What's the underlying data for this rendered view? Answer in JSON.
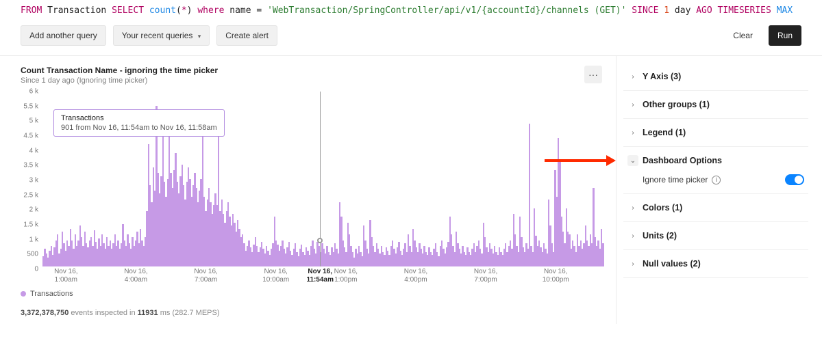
{
  "query": {
    "tokens": [
      {
        "t": "FROM",
        "c": "kw"
      },
      {
        "t": " "
      },
      {
        "t": "Transaction",
        "c": "ent"
      },
      {
        "t": " "
      },
      {
        "t": "SELECT",
        "c": "kw"
      },
      {
        "t": " "
      },
      {
        "t": "count",
        "c": "fn"
      },
      {
        "t": "(",
        "c": "ent"
      },
      {
        "t": "*",
        "c": "op"
      },
      {
        "t": ")",
        "c": "ent"
      },
      {
        "t": " "
      },
      {
        "t": "where",
        "c": "kw"
      },
      {
        "t": " "
      },
      {
        "t": "name",
        "c": "ent"
      },
      {
        "t": " = "
      },
      {
        "t": "'WebTransaction/SpringController/api/v1/{accountId}/channels (GET)'",
        "c": "str"
      },
      {
        "t": " "
      },
      {
        "t": "SINCE",
        "c": "kw"
      },
      {
        "t": " "
      },
      {
        "t": "1",
        "c": "num"
      },
      {
        "t": " "
      },
      {
        "t": "day",
        "c": "ent"
      },
      {
        "t": " "
      },
      {
        "t": "AGO",
        "c": "kw"
      },
      {
        "t": " "
      },
      {
        "t": "TIMESERIES",
        "c": "kw"
      },
      {
        "t": " "
      },
      {
        "t": "MAX",
        "c": "max"
      }
    ]
  },
  "toolbar": {
    "add_query": "Add another query",
    "recent": "Your recent queries",
    "create_alert": "Create alert",
    "clear": "Clear",
    "run": "Run"
  },
  "chart": {
    "title": "Count Transaction Name - ignoring the time picker",
    "subtitle": "Since 1 day ago (Ignoring time picker)",
    "tooltip_title": "Transactions",
    "tooltip_detail": "901 from Nov 16, 11:54am to Nov 16, 11:58am",
    "legend_label": "Transactions"
  },
  "footer": {
    "events": "3,372,378,750",
    "mid": " events inspected in ",
    "ms": "11931",
    "ms_unit": " ms ",
    "meps": "(282.7 MEPS)"
  },
  "sidebar": {
    "items": [
      {
        "label": "Y Axis (3)",
        "open": false
      },
      {
        "label": "Other groups (1)",
        "open": false
      },
      {
        "label": "Legend (1)",
        "open": false
      },
      {
        "label": "Dashboard Options",
        "open": true
      },
      {
        "label": "Colors (1)",
        "open": false
      },
      {
        "label": "Units (2)",
        "open": false
      },
      {
        "label": "Null values (2)",
        "open": false
      }
    ],
    "dashboard_options": {
      "ignore_label": "Ignore time picker",
      "ignore_on": true
    }
  },
  "chart_data": {
    "type": "area",
    "title": "Count Transaction Name - ignoring the time picker",
    "xlabel": "",
    "ylabel": "",
    "ylim": [
      0,
      6000
    ],
    "y_ticks": [
      "0",
      "500",
      "1 k",
      "1.5 k",
      "2 k",
      "2.5 k",
      "3 k",
      "3.5 k",
      "4 k",
      "4.5 k",
      "5 k",
      "5.5 k",
      "6 k"
    ],
    "x_ticks": [
      {
        "line1": "Nov 16,",
        "line2": "1:00am",
        "pos": 0.042,
        "bold": false
      },
      {
        "line1": "Nov 16,",
        "line2": "4:00am",
        "pos": 0.167,
        "bold": false
      },
      {
        "line1": "Nov 16,",
        "line2": "7:00am",
        "pos": 0.292,
        "bold": false
      },
      {
        "line1": "Nov 16,",
        "line2": "10:00am",
        "pos": 0.417,
        "bold": false
      },
      {
        "line1": "Nov 16,",
        "line2": "11:54am",
        "pos": 0.496,
        "bold": true
      },
      {
        "line1": "Nov 16,",
        "line2": "1:00pm",
        "pos": 0.542,
        "bold": false
      },
      {
        "line1": "Nov 16,",
        "line2": "4:00pm",
        "pos": 0.667,
        "bold": false
      },
      {
        "line1": "Nov 16,",
        "line2": "7:00pm",
        "pos": 0.792,
        "bold": false
      },
      {
        "line1": "Nov 16,",
        "line2": "10:00pm",
        "pos": 0.917,
        "bold": false
      }
    ],
    "highlight_x": 0.496,
    "highlight_y": 901,
    "series": [
      {
        "name": "Transactions",
        "color": "#c69ae6",
        "values": [
          350,
          600,
          450,
          300,
          550,
          700,
          400,
          650,
          900,
          1100,
          450,
          600,
          1200,
          800,
          550,
          900,
          700,
          1300,
          900,
          600,
          1100,
          700,
          900,
          1400,
          1000,
          700,
          1200,
          800,
          650,
          900,
          1000,
          700,
          1250,
          850,
          600,
          950,
          700,
          1100,
          800,
          600,
          1000,
          700,
          900,
          600,
          800,
          1100,
          700,
          900,
          600,
          800,
          1450,
          900,
          700,
          1100,
          800,
          600,
          1000,
          700,
          900,
          1200,
          800,
          1300,
          900,
          700,
          1000,
          1900,
          4200,
          2800,
          2200,
          3400,
          2600,
          5500,
          3200,
          2500,
          3100,
          4500,
          2900,
          2400,
          3000,
          5100,
          3200,
          2700,
          3300,
          3900,
          2900,
          2500,
          3100,
          3500,
          2800,
          2300,
          2900,
          3400,
          3000,
          2400,
          2800,
          3200,
          2700,
          2200,
          2600,
          3000,
          4900,
          2400,
          1900,
          2300,
          2700,
          2200,
          1800,
          2100,
          2500,
          2100,
          5200,
          1900,
          2300,
          1800,
          1500,
          1900,
          2200,
          1700,
          1400,
          1800,
          1500,
          1200,
          1600,
          1300,
          1000,
          1100,
          800,
          550,
          700,
          900,
          650,
          500,
          750,
          1000,
          700,
          500,
          650,
          850,
          600,
          450,
          700,
          550,
          400,
          600,
          800,
          1700,
          901,
          750,
          550,
          700,
          900,
          600,
          450,
          650,
          850,
          550,
          400,
          600,
          800,
          500,
          350,
          600,
          750,
          500,
          400,
          650,
          550,
          400,
          700,
          900,
          600,
          450,
          850,
          700,
          500,
          800,
          600,
          450,
          700,
          500,
          400,
          650,
          500,
          800,
          600,
          450,
          2200,
          1700,
          900,
          650,
          500,
          1500,
          1100,
          700,
          500,
          300,
          600,
          450,
          700,
          500,
          350,
          1400,
          900,
          600,
          450,
          1600,
          1000,
          700,
          500,
          800,
          600,
          450,
          700,
          500,
          400,
          650,
          550,
          400,
          700,
          900,
          600,
          450,
          650,
          850,
          550,
          400,
          600,
          800,
          500,
          1100,
          700,
          500,
          1300,
          900,
          650,
          500,
          800,
          600,
          450,
          700,
          500,
          400,
          650,
          500,
          400,
          600,
          800,
          500,
          350,
          700,
          900,
          600,
          450,
          650,
          850,
          1700,
          1100,
          700,
          500,
          1200,
          800,
          600,
          450,
          700,
          500,
          400,
          650,
          500,
          400,
          600,
          800,
          500,
          700,
          900,
          600,
          450,
          1500,
          1000,
          650,
          500,
          800,
          600,
          450,
          700,
          500,
          400,
          650,
          500,
          400,
          600,
          800,
          500,
          700,
          900,
          600,
          1800,
          1100,
          700,
          500,
          1700,
          1000,
          650,
          500,
          800,
          600,
          4900,
          700,
          500,
          2000,
          1050,
          700,
          900,
          650,
          500,
          800,
          600,
          450,
          2300,
          1400,
          800,
          500,
          3300,
          2400,
          4400,
          3600,
          1700,
          1200,
          800,
          2000,
          1200,
          1100,
          600,
          900,
          700,
          500,
          1100,
          700,
          900,
          600,
          800,
          1400,
          900,
          700,
          1100,
          800,
          2700,
          1000,
          700,
          900,
          600,
          1300,
          800
        ]
      }
    ]
  }
}
